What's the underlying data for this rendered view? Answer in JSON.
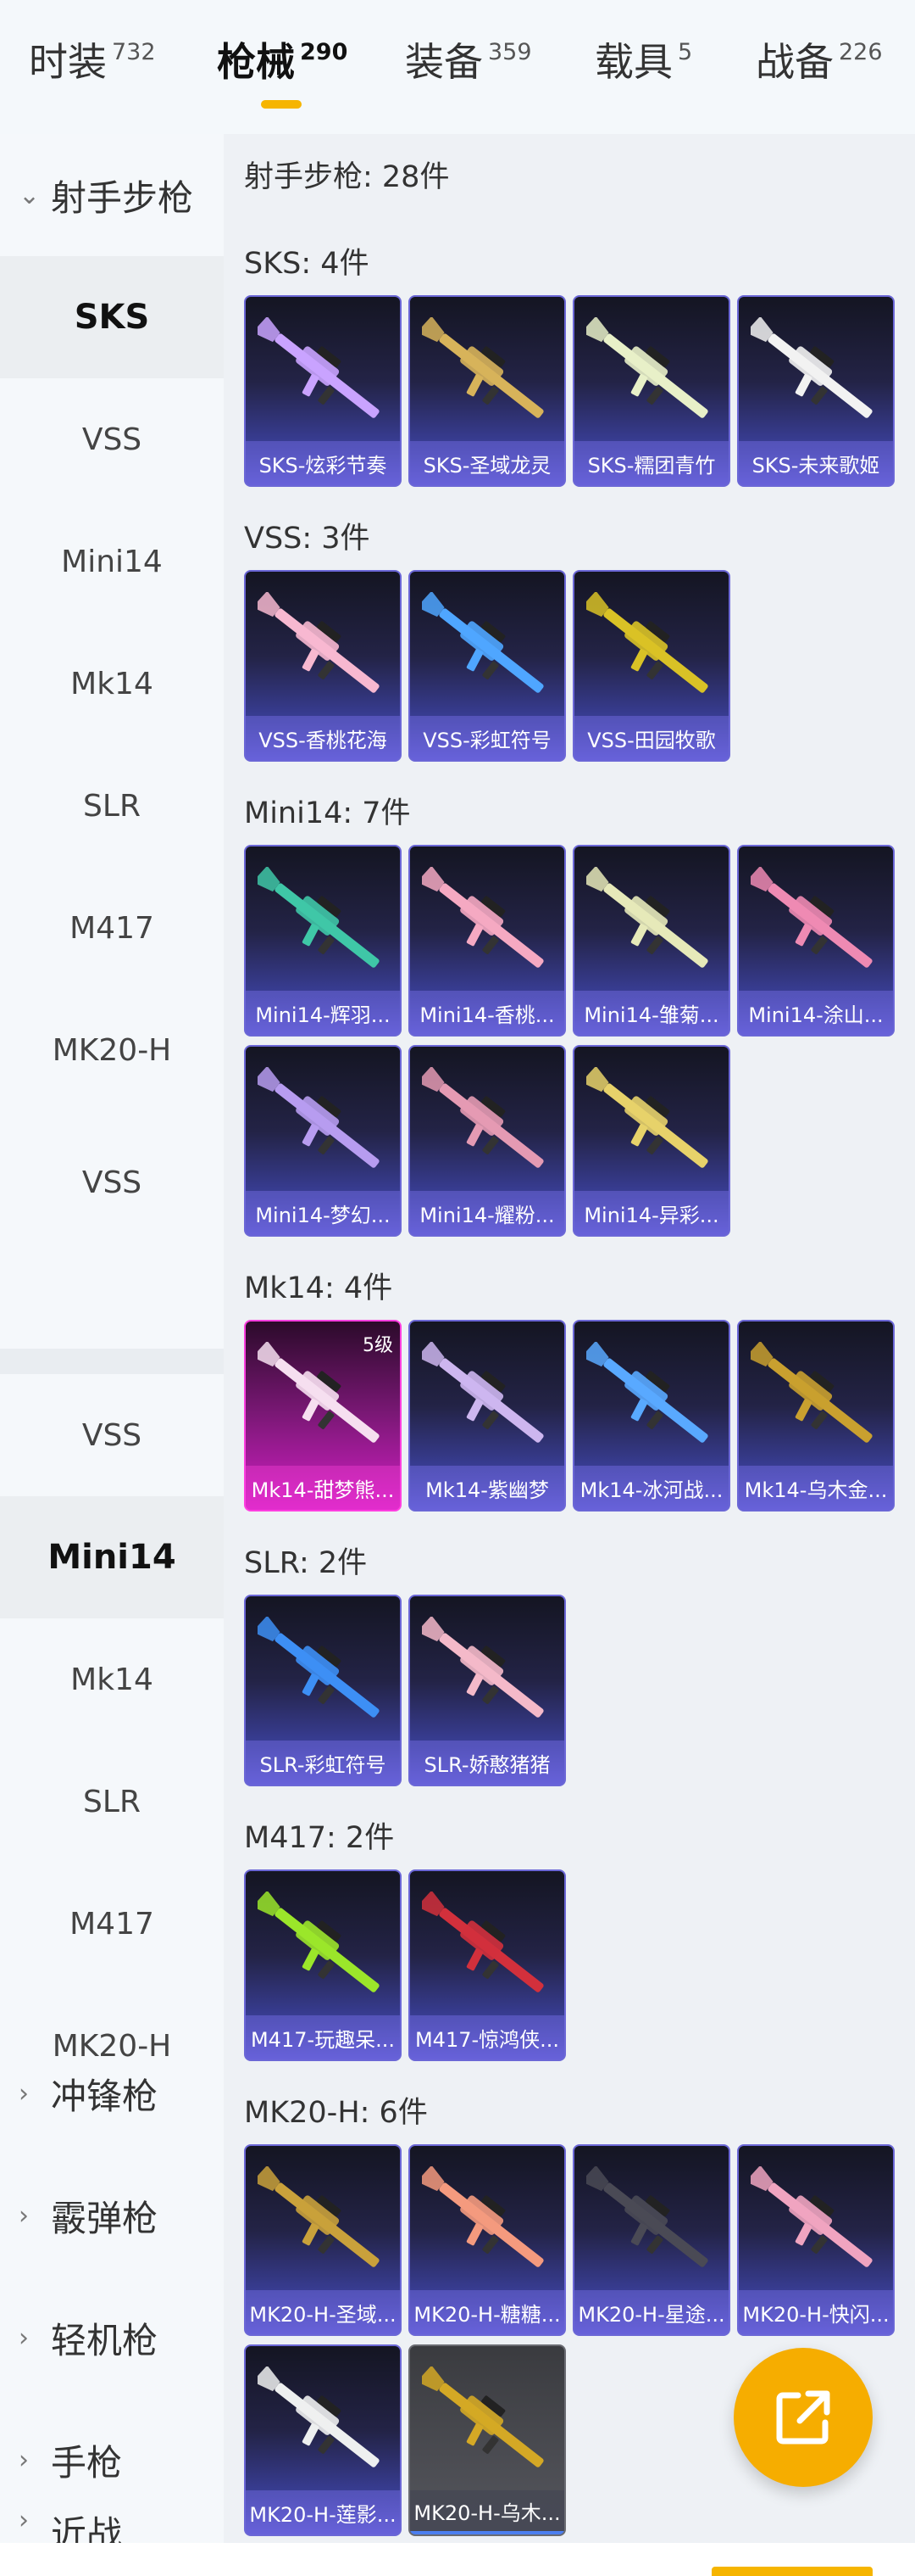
{
  "tabs": [
    {
      "label": "时装",
      "count": "732",
      "active": false
    },
    {
      "label": "枪械",
      "count": "290",
      "active": true
    },
    {
      "label": "装备",
      "count": "359",
      "active": false
    },
    {
      "label": "载具",
      "count": "5",
      "active": false
    },
    {
      "label": "战备",
      "count": "226",
      "active": false
    }
  ],
  "sidebar": {
    "category_open": "射手步枪",
    "items_a": [
      "SKS",
      "VSS",
      "Mini14",
      "Mk14",
      "SLR",
      "M417",
      "MK20-H",
      "VSS"
    ],
    "items_b": [
      "VSS",
      "Mini14",
      "Mk14",
      "SLR",
      "M417",
      "MK20-H"
    ],
    "active_a": "SKS",
    "active_b": "Mini14",
    "categories": [
      "冲锋枪",
      "霰弹枪",
      "轻机枪",
      "手枪",
      "近战"
    ]
  },
  "content": {
    "header": "射手步枪: 28件",
    "sections": [
      {
        "title": "SKS: 4件",
        "cards": [
          {
            "label": "SKS-炫彩节奏",
            "gun": "#c9a3ff"
          },
          {
            "label": "SKS-圣域龙灵",
            "gun": "#d7b35a"
          },
          {
            "label": "SKS-糯团青竹",
            "gun": "#e8f0c8"
          },
          {
            "label": "SKS-未来歌姬",
            "gun": "#f2f2f2"
          }
        ]
      },
      {
        "title": "VSS: 3件",
        "cards": [
          {
            "label": "VSS-香桃花海",
            "gun": "#f7b8d0"
          },
          {
            "label": "VSS-彩虹符号",
            "gun": "#4fa6ff"
          },
          {
            "label": "VSS-田园牧歌",
            "gun": "#d9c226"
          }
        ]
      },
      {
        "title": "Mini14: 7件",
        "cards": [
          {
            "label": "Mini14-辉羽...",
            "gun": "#3fc7a7"
          },
          {
            "label": "Mini14-香桃...",
            "gun": "#f5a9c2"
          },
          {
            "label": "Mini14-雏菊...",
            "gun": "#e6e9b9"
          },
          {
            "label": "Mini14-涂山...",
            "gun": "#ee8ab3"
          },
          {
            "label": "Mini14-梦幻...",
            "gun": "#b79cf0"
          },
          {
            "label": "Mini14-耀粉...",
            "gun": "#e49ab3"
          },
          {
            "label": "Mini14-异彩...",
            "gun": "#e7d26a"
          }
        ]
      },
      {
        "title": "Mk14: 4件",
        "cards": [
          {
            "label": "Mk14-甜梦熊...",
            "gun": "#f6dff0",
            "style": "pink",
            "level": "5级"
          },
          {
            "label": "Mk14-紫幽梦",
            "gun": "#cdb6ef"
          },
          {
            "label": "Mk14-冰河战...",
            "gun": "#59a9ff"
          },
          {
            "label": "Mk14-乌木金...",
            "gun": "#c9a02f"
          }
        ]
      },
      {
        "title": "SLR: 2件",
        "cards": [
          {
            "label": "SLR-彩虹符号",
            "gun": "#3d8ff5"
          },
          {
            "label": "SLR-娇憨猪猪",
            "gun": "#f4b9c9"
          }
        ]
      },
      {
        "title": "M417: 2件",
        "cards": [
          {
            "label": "M417-玩趣呆...",
            "gun": "#9be62a"
          },
          {
            "label": "M417-惊鸿侠...",
            "gun": "#d2303c"
          }
        ]
      },
      {
        "title": "MK20-H: 6件",
        "cards": [
          {
            "label": "MK20-H-圣域...",
            "gun": "#c9a13b"
          },
          {
            "label": "MK20-H-糖糖...",
            "gun": "#f49a7e"
          },
          {
            "label": "MK20-H-星途...",
            "gun": "#4a4a55"
          },
          {
            "label": "MK20-H-快闪...",
            "gun": "#f0a4c0"
          },
          {
            "label": "MK20-H-莲影...",
            "gun": "#eef0f0"
          },
          {
            "label": "MK20-H-乌木...",
            "gun": "#d4a825",
            "style": "gray"
          }
        ]
      }
    ]
  },
  "fab_icon": "share-export-icon",
  "colors": {
    "accent": "#f6b500",
    "fab": "#f6ad00",
    "card_border": "#6b67d6"
  }
}
